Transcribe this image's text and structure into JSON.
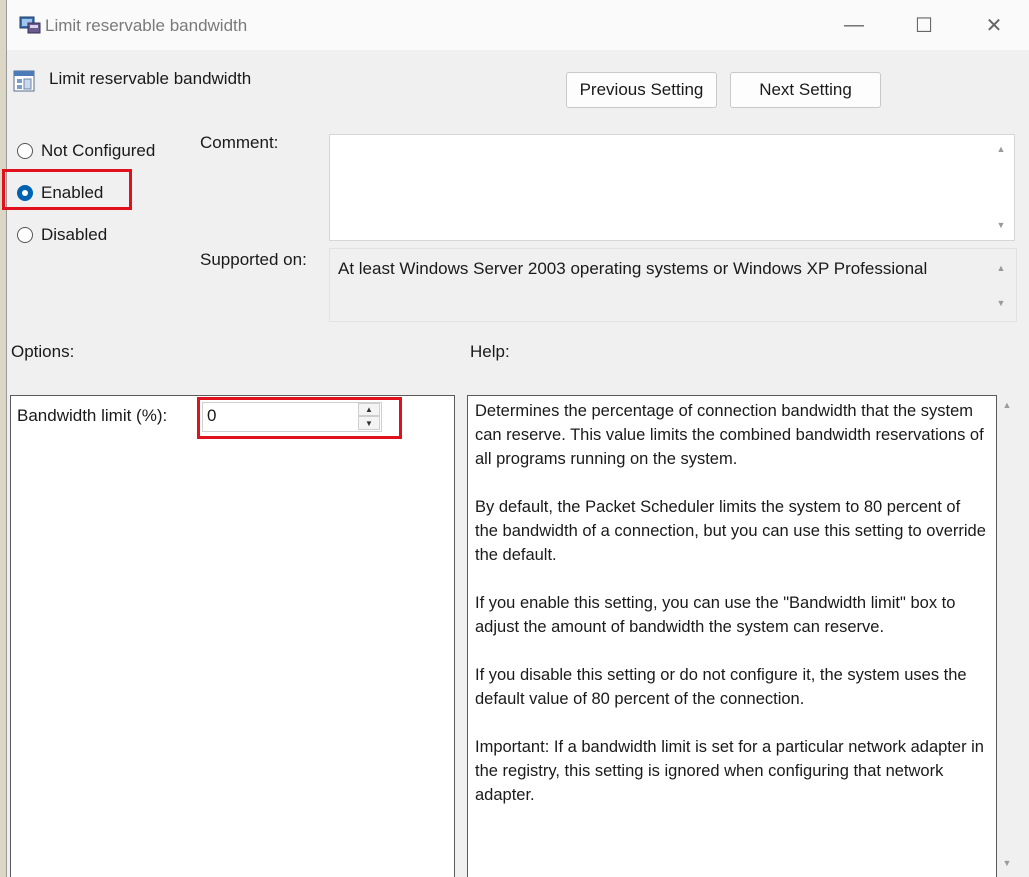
{
  "window": {
    "title": "Limit reservable bandwidth",
    "minimize_glyph": "—",
    "maximize_glyph": "☐",
    "close_glyph": "✕"
  },
  "header": {
    "title": "Limit reservable bandwidth",
    "icon": "policy-setting-icon"
  },
  "nav": {
    "previous_label": "Previous Setting",
    "next_label": "Next Setting"
  },
  "state": {
    "options": [
      {
        "label": "Not Configured",
        "selected": false
      },
      {
        "label": "Enabled",
        "selected": true
      },
      {
        "label": "Disabled",
        "selected": false
      }
    ]
  },
  "comment": {
    "label": "Comment:",
    "value": ""
  },
  "supported": {
    "label": "Supported on:",
    "value": "At least Windows Server 2003 operating systems or Windows XP Professional"
  },
  "options": {
    "label": "Options:",
    "bandwidth_label": "Bandwidth limit (%):",
    "bandwidth_value": "0"
  },
  "help": {
    "label": "Help:",
    "paragraphs": [
      "Determines the percentage of connection bandwidth that the system can reserve. This value limits the combined bandwidth reservations of all programs running on the system.",
      "By default, the Packet Scheduler limits the system to 80 percent of the bandwidth of a connection, but you can use this setting to override the default.",
      "If you enable this setting, you can use the \"Bandwidth limit\" box to adjust the amount of bandwidth the system can reserve.",
      "If you disable this setting or do not configure it, the system uses the default value of 80 percent of the connection.",
      "Important: If a bandwidth limit is set for a particular network adapter in the registry, this setting is ignored when configuring that network adapter."
    ]
  },
  "colors": {
    "highlight": "#e0111c",
    "radio_selected": "#0063b1"
  }
}
